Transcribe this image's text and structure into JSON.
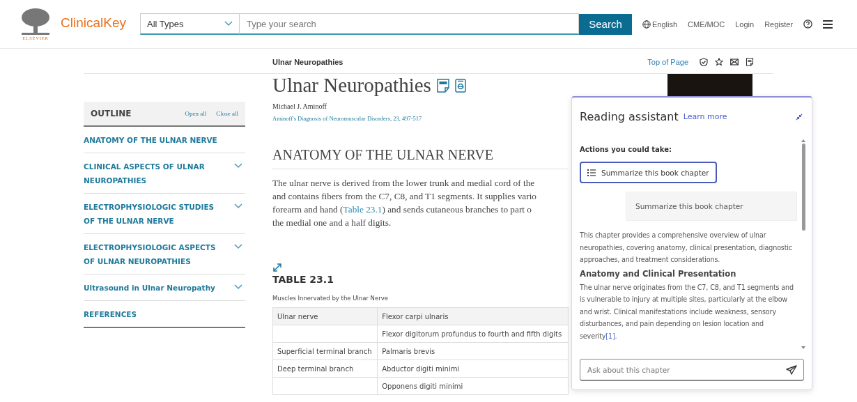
{
  "header": {
    "logo_text": "ClinicalKey",
    "publisher": "ELSEVIER",
    "type_select": "All Types",
    "search_placeholder": "Type your search",
    "search_button": "Search",
    "language": "English",
    "links": [
      "CME/MOC",
      "Login",
      "Register"
    ]
  },
  "breadcrumb": "Ulnar Neuropathies",
  "top_of_page": "Top of Page",
  "outline": {
    "title": "OUTLINE",
    "open_all": "Open all",
    "close_all": "Close all",
    "items": [
      {
        "label": "ANATOMY OF THE ULNAR NERVE",
        "expandable": false
      },
      {
        "label": "CLINICAL ASPECTS OF ULNAR NEUROPATHIES",
        "expandable": true
      },
      {
        "label": "ELECTROPHYSIOLOGIC STUDIES OF THE ULNAR NERVE",
        "expandable": true
      },
      {
        "label": "ELECTROPHYSIOLOGIC ASPECTS OF ULNAR NEUROPATHIES",
        "expandable": true
      },
      {
        "label": "Ultrasound in Ulnar Neuropathy",
        "expandable": true
      },
      {
        "label": "REFERENCES",
        "expandable": false
      }
    ]
  },
  "article": {
    "title": "Ulnar Neuropathies",
    "author": "Michael J. Aminoff",
    "source": "Aminoff's Diagnosis of Neuromuscular Disorders, 23, 497-517",
    "section_title": "ANATOMY OF THE ULNAR NERVE",
    "paragraph_lines": [
      [
        {
          "kind": "text",
          "text": "The ulnar nerve is derived from the lower trunk and medial cord of the"
        }
      ],
      [
        {
          "kind": "text",
          "text": "and contains fibers from the C7, C8, and T1 segments. It supplies vario"
        }
      ],
      [
        {
          "kind": "text",
          "text": "forearm and hand ("
        },
        {
          "kind": "link",
          "text": "Table 23.1"
        },
        {
          "kind": "text",
          "text": ") and sends cutaneous branches to part o"
        }
      ],
      [
        {
          "kind": "text",
          "text": "the medial one and a half digits."
        }
      ]
    ],
    "table_title": "TABLE 23.1",
    "table_caption": "Muscles Innervated by the Ulnar Nerve",
    "table_rows": [
      {
        "kind": "head",
        "cells": [
          "Ulnar nerve",
          "Flexor carpi ulnaris"
        ]
      },
      {
        "kind": "body",
        "cells": [
          "",
          "Flexor digitorum profundus to fourth and fifth digits"
        ]
      },
      {
        "kind": "body",
        "cells": [
          "Superficial terminal branch",
          "Palmaris brevis"
        ]
      },
      {
        "kind": "body",
        "cells": [
          "Deep terminal branch",
          "Abductor digiti minimi"
        ]
      },
      {
        "kind": "body",
        "cells": [
          "",
          "Opponens digiti minimi"
        ]
      }
    ]
  },
  "assistant": {
    "title": "Reading assistant",
    "learn_more": "Learn more",
    "actions_label": "Actions you could take:",
    "action_button": "Summarize this book chapter",
    "user_message": "Summarize this book chapter",
    "response": [
      {
        "kind": "text",
        "text": "This chapter provides a comprehensive overview of ulnar neuropathies, covering anatomy, clinical presentation, diagnostic approaches, and treatment considerations."
      },
      {
        "kind": "heading",
        "text": "Anatomy and Clinical Presentation"
      },
      {
        "kind": "text",
        "text": "The ulnar nerve originates from the C7, C8, and T1 segments and is vulnerable to injury at multiple sites, particularly at the elbow and wrist. Clinical manifestations include weakness, sensory disturbances, and pain depending on lesion location and severity",
        "ref": "[1]",
        "suffix": "."
      }
    ],
    "input_placeholder": "Ask about this chapter"
  }
}
